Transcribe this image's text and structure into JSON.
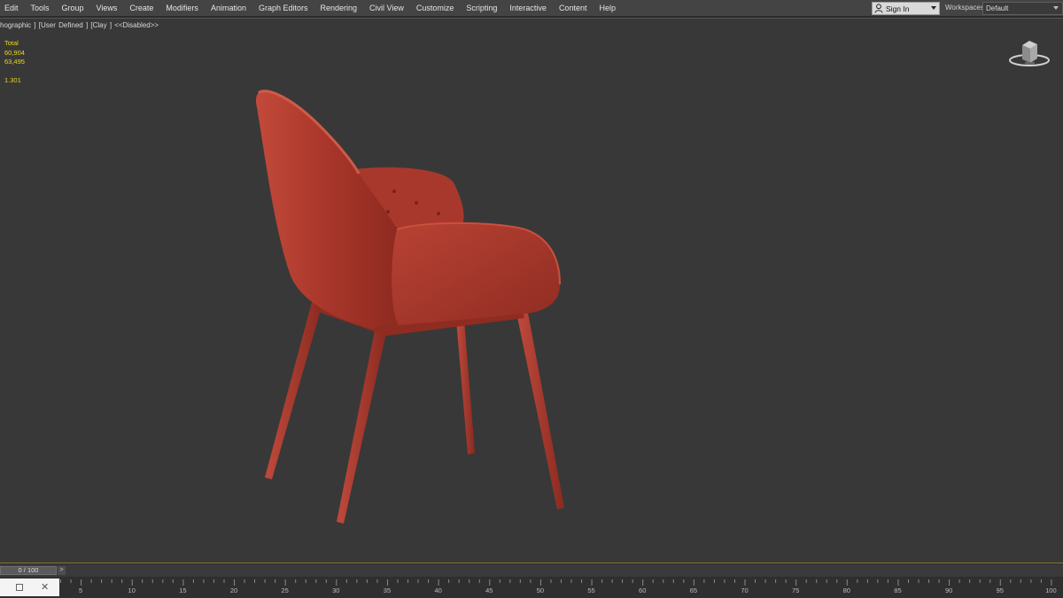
{
  "menubar": {
    "items": [
      "Edit",
      "Tools",
      "Group",
      "Views",
      "Create",
      "Modifiers",
      "Animation",
      "Graph Editors",
      "Rendering",
      "Civil View",
      "Customize",
      "Scripting",
      "Interactive",
      "Content",
      "Help"
    ],
    "signin_label": "Sign In",
    "workspaces_label": "Workspaces:",
    "workspace_value": "Default"
  },
  "viewport": {
    "label": "hographic ] [User Defined ] [Clay ]  <<Disabled>>",
    "stats": {
      "title": "Total",
      "polys": "60,904",
      "verts": "63,495",
      "fps": "1.301"
    },
    "object_color": "#b03a2e",
    "background_color": "#383838"
  },
  "timeline": {
    "frame_label": "0 / 100",
    "next_label": ">",
    "ticks": [
      "5",
      "10",
      "15",
      "20",
      "25",
      "30",
      "35",
      "40",
      "45",
      "50",
      "55",
      "60",
      "65",
      "70",
      "75",
      "80",
      "85",
      "90",
      "95",
      "100"
    ]
  },
  "icons": {
    "user": "user-icon",
    "viewcube": "viewcube-icon",
    "minimize": "square-icon",
    "close": "close-icon"
  }
}
